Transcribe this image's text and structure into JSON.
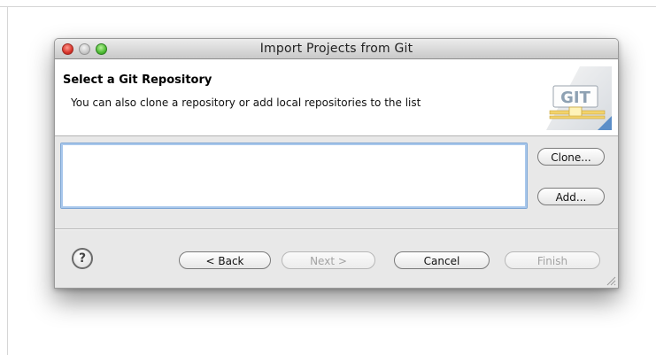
{
  "window": {
    "title": "Import Projects from Git"
  },
  "header": {
    "title": "Select a Git Repository",
    "description": "You can also clone a repository or add local repositories to the list",
    "icon": "git-logo-icon",
    "icon_text": "GIT"
  },
  "repository_list": {
    "items": []
  },
  "side_buttons": {
    "clone_label": "Clone...",
    "add_label": "Add..."
  },
  "footer": {
    "help_label": "?",
    "back_label": "< Back",
    "next_label": "Next >",
    "cancel_label": "Cancel",
    "finish_label": "Finish"
  },
  "colors": {
    "list_focus_border": "#7fa7d4",
    "window_background": "#e8e8e8"
  }
}
